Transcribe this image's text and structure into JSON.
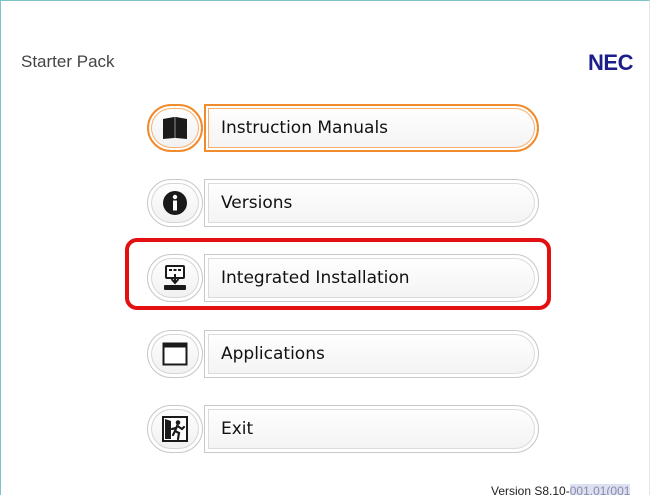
{
  "window": {
    "title": "Starter Pack",
    "logo": "NEC"
  },
  "menu": {
    "items": [
      {
        "id": "instruction-manuals",
        "label": "Instruction Manuals",
        "icon": "book-icon",
        "active": true
      },
      {
        "id": "versions",
        "label": "Versions",
        "icon": "info-icon",
        "active": false
      },
      {
        "id": "integrated-installation",
        "label": "Integrated Installation",
        "icon": "install-icon",
        "active": false,
        "highlighted": true
      },
      {
        "id": "applications",
        "label": "Applications",
        "icon": "window-icon",
        "active": false
      },
      {
        "id": "exit",
        "label": "Exit",
        "icon": "exit-door-icon",
        "active": false
      }
    ]
  },
  "footer": {
    "version_prefix": "Version S8.10-",
    "version_suffix": "001.01(001"
  },
  "colors": {
    "accent_orange": "#f08c2e",
    "highlight_red": "#e21010",
    "brand_blue": "#1c1f8a"
  }
}
